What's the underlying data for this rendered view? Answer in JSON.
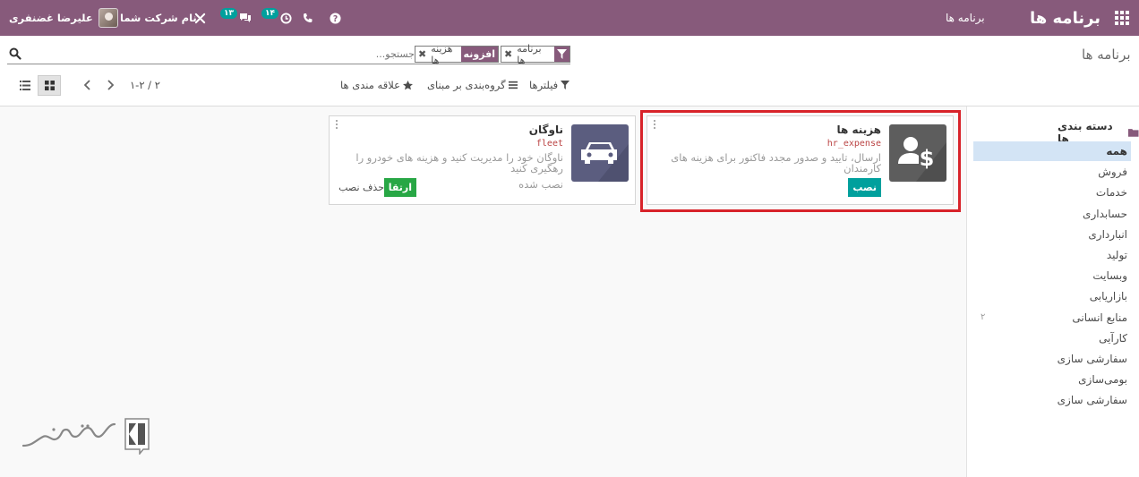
{
  "navbar": {
    "brand": "برنامه ها",
    "menu_item": "برنامه ها",
    "user_name": "علیرضا غضنفری",
    "company_name": "نام شرکت شما",
    "chat_badge": "۱۳",
    "activity_badge": "۱۴"
  },
  "control_panel": {
    "title": "برنامه ها",
    "search_placeholder": "جستجو...",
    "facets": [
      {
        "label": "برنامه ها"
      },
      {
        "tag": "افزونه",
        "label": "هزینه ها"
      }
    ],
    "filters_label": "فیلترها",
    "group_label": "گروه‌بندی بر مبنای",
    "favorites_label": "علاقه مندی ها",
    "pager": "۱-۲ / ۲"
  },
  "sidebar": {
    "title": "دسته بندی ها",
    "items": [
      {
        "label": "همه",
        "count": ""
      },
      {
        "label": "فروش",
        "count": ""
      },
      {
        "label": "خدمات",
        "count": ""
      },
      {
        "label": "حسابداری",
        "count": ""
      },
      {
        "label": "انبارداری",
        "count": ""
      },
      {
        "label": "تولید",
        "count": ""
      },
      {
        "label": "وبسایت",
        "count": ""
      },
      {
        "label": "بازاریابی",
        "count": ""
      },
      {
        "label": "منابع انسانی",
        "count": "۲"
      },
      {
        "label": "کارآیی",
        "count": ""
      },
      {
        "label": "سفارشی سازی",
        "count": ""
      },
      {
        "label": "بومی‌سازی",
        "count": ""
      },
      {
        "label": "سفارشی سازی",
        "count": ""
      }
    ]
  },
  "cards": [
    {
      "title": "هزینه ها",
      "tech_name": "hr_expense",
      "description": "ارسال، تایید و صدور مجدد فاکتور برای هزینه های کارمندان",
      "install_label": "نصب",
      "icon": "expense-user-dollar-icon",
      "icon_color": "#5d5d5d"
    },
    {
      "title": "ناوگان",
      "tech_name": "fleet",
      "description": "ناوگان خود را مدیریت کنید و هزینه های خودرو را رهگیری کنید",
      "status": "نصب شده",
      "upgrade_label": "ارتقا",
      "uninstall_label": "حذف نصب",
      "icon": "car-icon",
      "icon_color": "#5b5d7f"
    }
  ],
  "colors": {
    "brand": "#875a7b",
    "badge": "#00a09d",
    "install_button": "#00a09d",
    "upgrade_button": "#28a745",
    "highlight_border": "#d8232a",
    "active_category": "#d3e4f5"
  }
}
